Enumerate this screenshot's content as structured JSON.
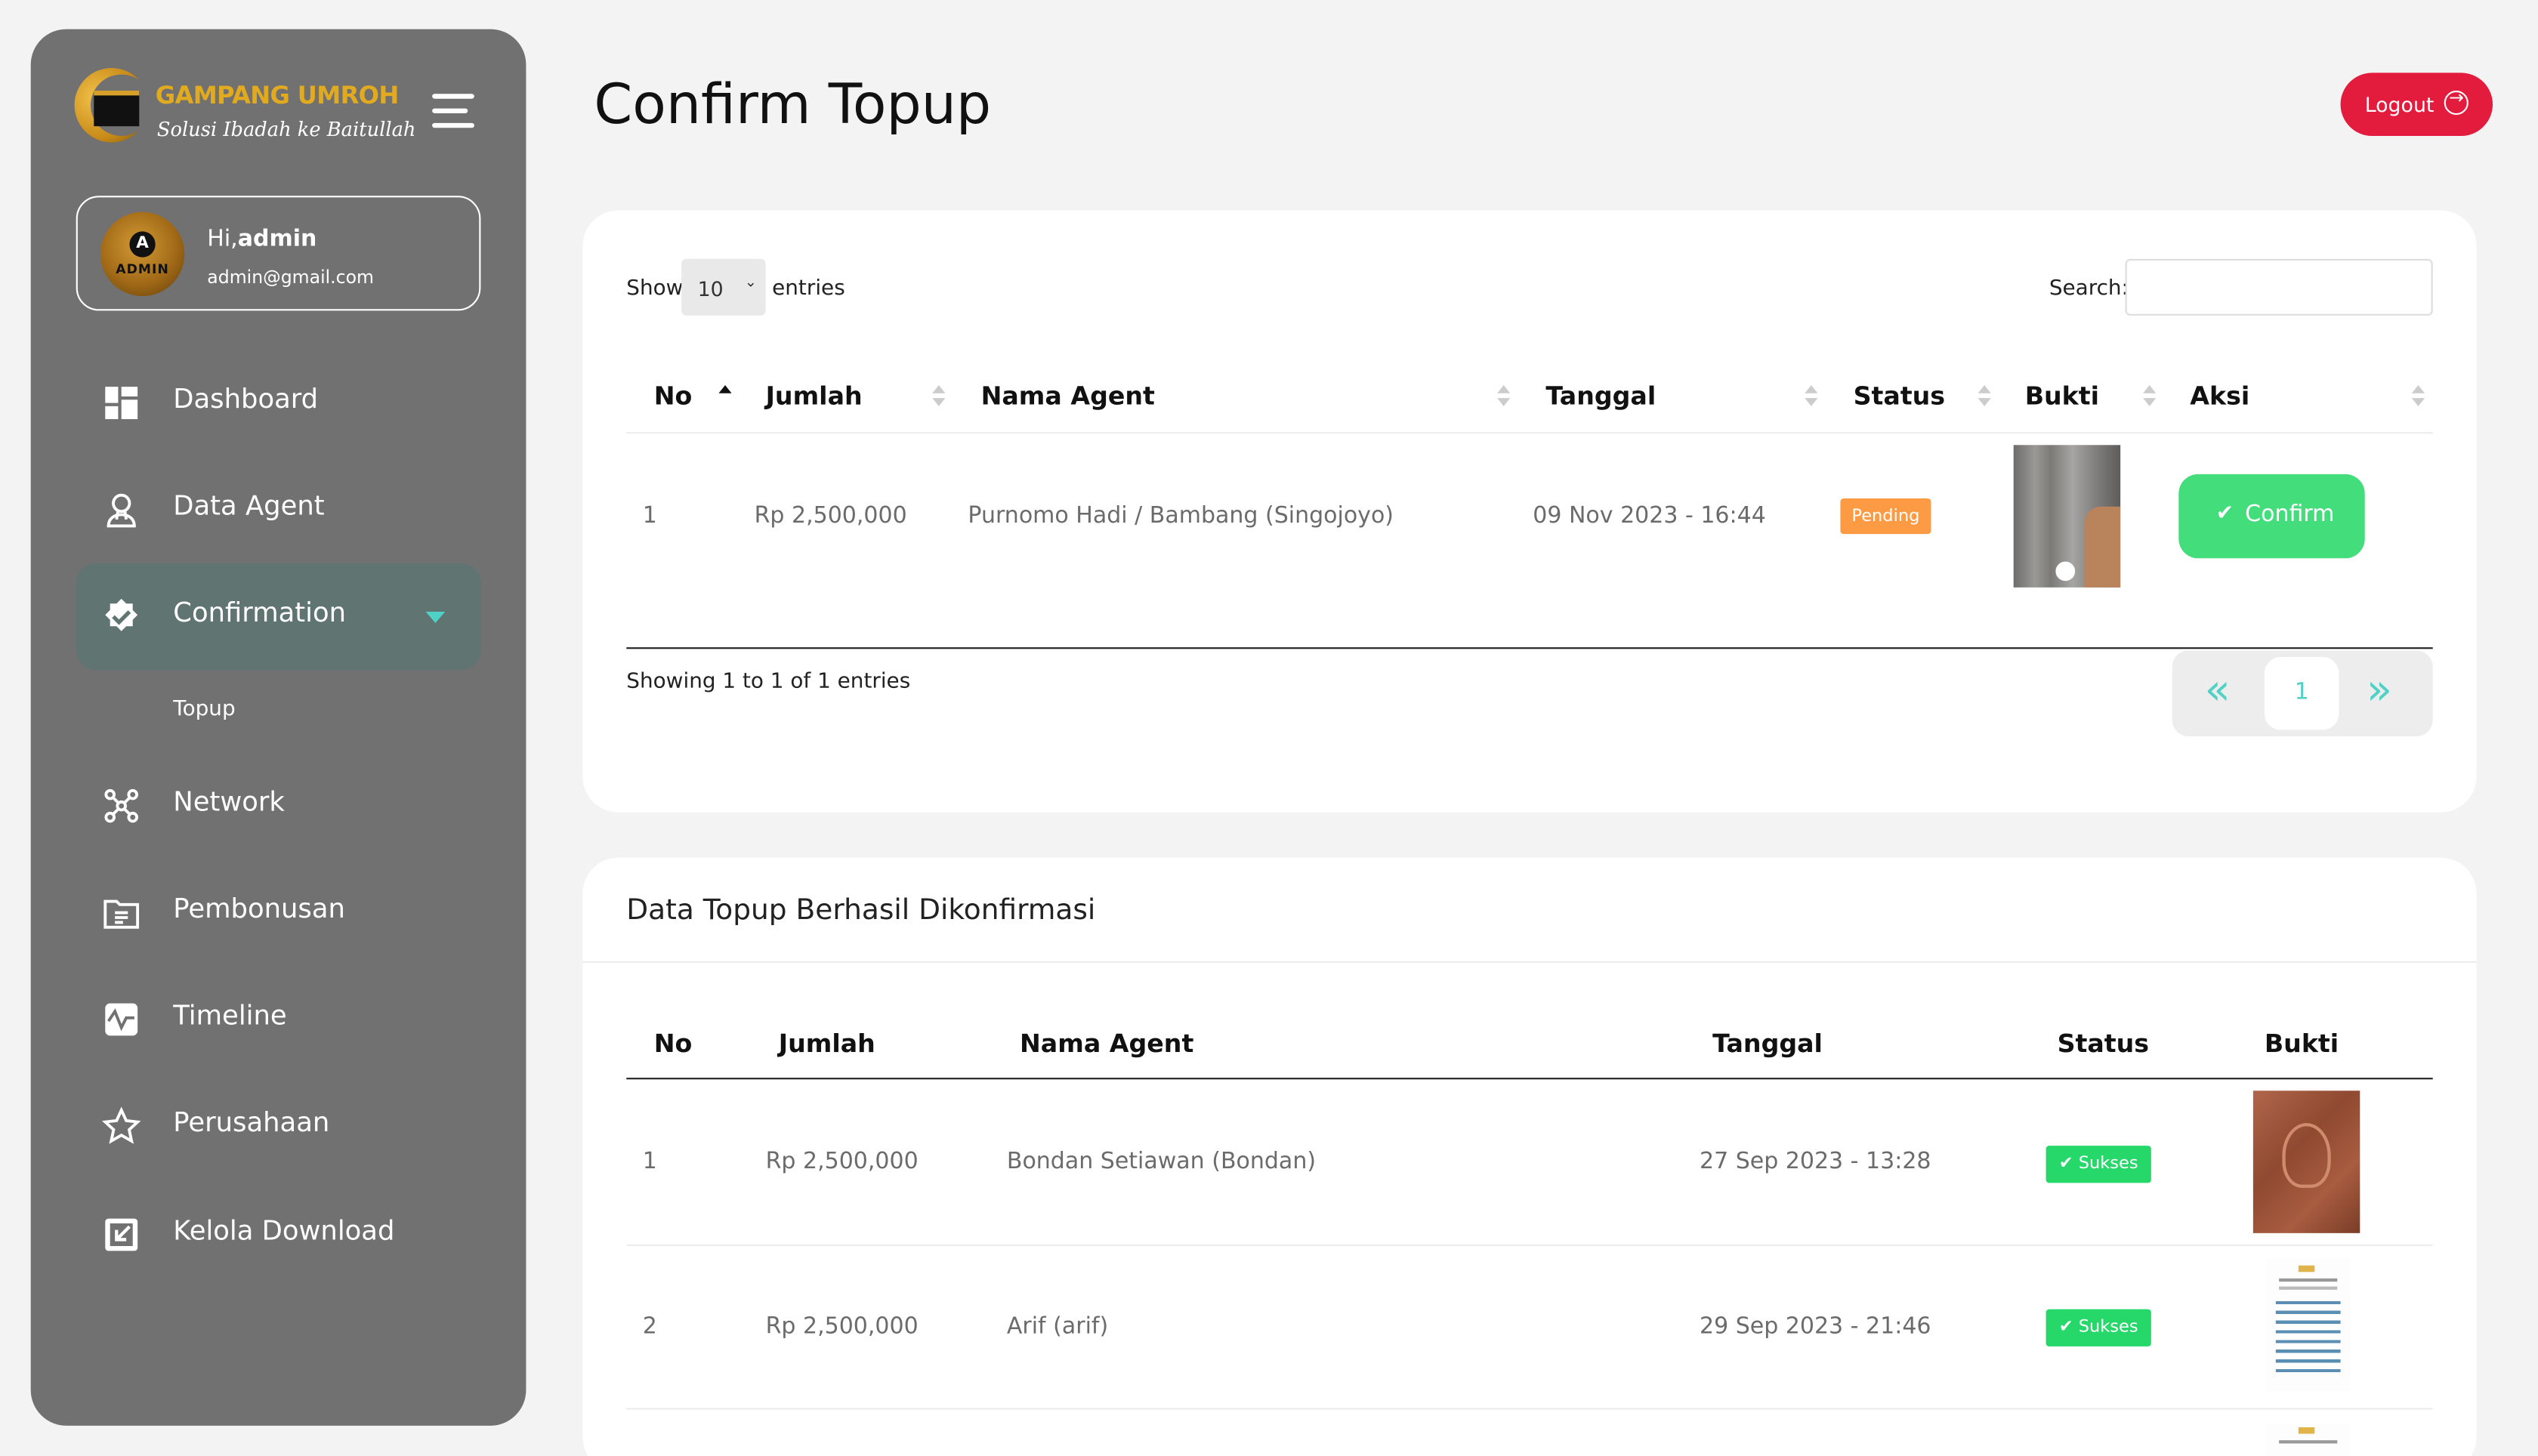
{
  "brand": {
    "name": "GAMPANG UMROH",
    "tagline": "Solusi Ibadah ke Baitullah"
  },
  "profile": {
    "greeting": "Hi,",
    "username": "admin",
    "email": "admin@gmail.com",
    "avatar_text": "ADMIN",
    "avatar_letter": "A"
  },
  "sidebar": {
    "items": [
      {
        "label": "Dashboard",
        "icon": "dashboard-icon"
      },
      {
        "label": "Data Agent",
        "icon": "agent-icon"
      },
      {
        "label": "Confirmation",
        "icon": "badge-check-icon",
        "active": true
      },
      {
        "label": "Network",
        "icon": "network-icon"
      },
      {
        "label": "Pembonusan",
        "icon": "bonus-icon"
      },
      {
        "label": "Timeline",
        "icon": "timeline-icon"
      },
      {
        "label": "Perusahaan",
        "icon": "star-icon"
      },
      {
        "label": "Kelola Download",
        "icon": "download-icon"
      }
    ],
    "sub_item": "Topup"
  },
  "header": {
    "title": "Confirm Topup",
    "logout_label": "Logout"
  },
  "pending_table": {
    "show_label": "Show",
    "entries_value": "10",
    "entries_label": "entries",
    "search_label": "Search:",
    "search_value": "",
    "columns": [
      "No",
      "Jumlah",
      "Nama Agent",
      "Tanggal",
      "Status",
      "Bukti",
      "Aksi"
    ],
    "rows": [
      {
        "no": "1",
        "jumlah": "Rp 2,500,000",
        "nama_agent": "Purnomo Hadi / Bambang (Singojoyo)",
        "tanggal": "09 Nov 2023 - 16:44",
        "status": "Pending",
        "action": "Confirm"
      }
    ],
    "info": "Showing 1 to 1 of 1 entries",
    "pagination": {
      "prev": "«",
      "current": "1",
      "next": "»"
    }
  },
  "confirmed_table": {
    "title": "Data Topup Berhasil Dikonfirmasi",
    "columns": [
      "No",
      "Jumlah",
      "Nama Agent",
      "Tanggal",
      "Status",
      "Bukti"
    ],
    "rows": [
      {
        "no": "1",
        "jumlah": "Rp 2,500,000",
        "nama_agent": "Bondan Setiawan (Bondan)",
        "tanggal": "27 Sep 2023 - 13:28",
        "status": "Sukses"
      },
      {
        "no": "2",
        "jumlah": "Rp 2,500,000",
        "nama_agent": "Arif (arif)",
        "tanggal": "29 Sep 2023 - 21:46",
        "status": "Sukses"
      }
    ]
  },
  "colors": {
    "sidebar": "#717171",
    "accent": "#4fd1c5",
    "logout": "#e31b3c",
    "pending": "#fd9b45",
    "success": "#26d76a",
    "confirm": "#43dd7c"
  }
}
